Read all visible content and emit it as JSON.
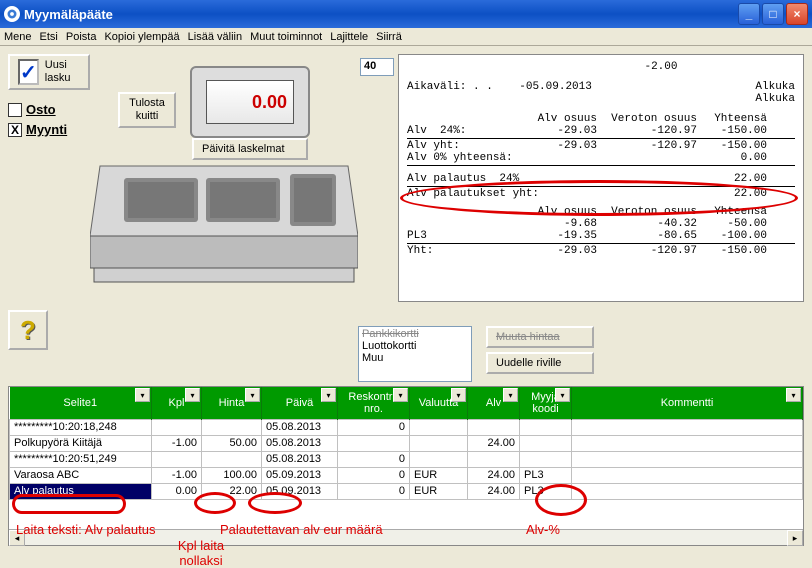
{
  "window": {
    "title": "Myymäläpääte"
  },
  "menu": {
    "items": [
      "Mene",
      "Etsi",
      "Poista",
      "Kopioi ylempää",
      "Lisää väliin",
      "Muut toiminnot",
      "Lajittele",
      "Siirrä"
    ]
  },
  "buttons": {
    "uusi_lasku": "Uusi lasku",
    "tulosta_kuitti": "Tulosta kuitti",
    "paivita_laskelmat": "Päivitä laskelmat",
    "muuta_hintaa": "Muuta hintaa",
    "uudelle_riville": "Uudelle riville"
  },
  "radios": {
    "osto": "Osto",
    "myynti": "Myynti"
  },
  "register_display": "0.00",
  "field40": "40",
  "paylist": {
    "items": [
      "Pankkikortti",
      "Luottokortti",
      "Muu"
    ],
    "strike_first": true
  },
  "receipt": {
    "top_amount": "-2.00",
    "aikavali_label": "Aikaväli:",
    "aikavali_value": ". .    -05.09.2013",
    "right_labels": [
      "Alkuka",
      "Alkuka"
    ],
    "headers": [
      "Alv osuus",
      "Veroton osuus",
      "Yhteensä"
    ],
    "rows1": [
      {
        "l": "Alv  24%:",
        "a": "-29.03",
        "b": "-120.97",
        "c": "-150.00"
      },
      {
        "l": "Alv yht:",
        "a": "-29.03",
        "b": "-120.97",
        "c": "-150.00"
      },
      {
        "l": "Alv 0% yhteensä:",
        "a": "",
        "b": "",
        "c": "0.00"
      }
    ],
    "rows2": [
      {
        "l": "Alv palautus  24%",
        "a": "",
        "b": "",
        "c": "22.00"
      },
      {
        "l": "Alv palautukset yht:",
        "a": "",
        "b": "",
        "c": "22.00"
      }
    ],
    "rows3": [
      {
        "l": "",
        "a": "-9.68",
        "b": "-40.32",
        "c": "-50.00"
      },
      {
        "l": "PL3",
        "a": "-19.35",
        "b": "-80.65",
        "c": "-100.00"
      },
      {
        "l": "Yht:",
        "a": "-29.03",
        "b": "-120.97",
        "c": "-150.00"
      }
    ]
  },
  "grid": {
    "headers": [
      "Selite1",
      "Kpl",
      "Hinta",
      "Päivä",
      "Reskontra nro.",
      "Valuutta",
      "Alv",
      "Myyjä koodi",
      "Kommentti"
    ],
    "rows": [
      {
        "selite": "*********10:20:18,248",
        "kpl": "",
        "hinta": "",
        "paiva": "05.08.2013",
        "resk": "0",
        "val": "",
        "alv": "",
        "koodi": "",
        "kom": ""
      },
      {
        "selite": "Polkupyörä Kiitäjä",
        "kpl": "-1.00",
        "hinta": "50.00",
        "paiva": "05.08.2013",
        "resk": "",
        "val": "",
        "alv": "24.00",
        "koodi": "",
        "kom": ""
      },
      {
        "selite": "*********10:20:51,249",
        "kpl": "",
        "hinta": "",
        "paiva": "05.08.2013",
        "resk": "0",
        "val": "",
        "alv": "",
        "koodi": "",
        "kom": ""
      },
      {
        "selite": "Varaosa ABC",
        "kpl": "-1.00",
        "hinta": "100.00",
        "paiva": "05.09.2013",
        "resk": "0",
        "val": "EUR",
        "alv": "24.00",
        "koodi": "PL3",
        "kom": ""
      },
      {
        "selite": "Alv palautus",
        "kpl": "0.00",
        "hinta": "22.00",
        "paiva": "05.09.2013",
        "resk": "0",
        "val": "EUR",
        "alv": "24.00",
        "koodi": "PL3",
        "kom": "",
        "sel": true
      }
    ]
  },
  "annotations": {
    "a1": "Laita teksti: Alv palautus",
    "a2": "Kpl laita nollaksi",
    "a3": "Palautettavan alv eur määrä",
    "a4": "Alv-%"
  }
}
